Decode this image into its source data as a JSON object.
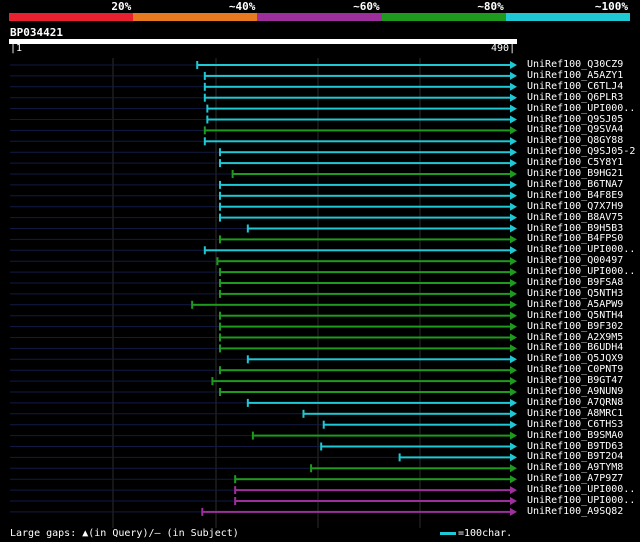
{
  "legend": {
    "colors": [
      "#e8202f",
      "#e8791e",
      "#9c2f9c",
      "#1e9a1e",
      "#1ec8d4"
    ],
    "labels": [
      "20%",
      "~40%",
      "~60%",
      "~80%",
      "~100%"
    ]
  },
  "query": {
    "name": "BP034421",
    "start": "1",
    "end": "490"
  },
  "hits": [
    {
      "label": "UniRef100_Q30CZ9",
      "color": "cyan",
      "start": 0.37
    },
    {
      "label": "UniRef100_A5AZY1",
      "color": "cyan",
      "start": 0.385
    },
    {
      "label": "UniRef100_C6TLJ4",
      "color": "cyan",
      "start": 0.385
    },
    {
      "label": "UniRef100_Q6PLR3",
      "color": "cyan",
      "start": 0.385
    },
    {
      "label": "UniRef100_UPI000..",
      "color": "cyan",
      "start": 0.39
    },
    {
      "label": "UniRef100_Q9SJ05",
      "color": "cyan",
      "start": 0.39
    },
    {
      "label": "UniRef100_Q9SVA4",
      "color": "green",
      "start": 0.385
    },
    {
      "label": "UniRef100_Q8GY88",
      "color": "cyan",
      "start": 0.385
    },
    {
      "label": "UniRef100_Q9SJ05-2",
      "color": "cyan",
      "start": 0.415
    },
    {
      "label": "UniRef100_C5Y8Y1",
      "color": "cyan",
      "start": 0.415
    },
    {
      "label": "UniRef100_B9HG21",
      "color": "green",
      "start": 0.44
    },
    {
      "label": "UniRef100_B6TNA7",
      "color": "cyan",
      "start": 0.415
    },
    {
      "label": "UniRef100_B4F8E9",
      "color": "cyan",
      "start": 0.415
    },
    {
      "label": "UniRef100_Q7X7H9",
      "color": "cyan",
      "start": 0.415
    },
    {
      "label": "UniRef100_B8AV75",
      "color": "cyan",
      "start": 0.415
    },
    {
      "label": "UniRef100_B9H5B3",
      "color": "cyan",
      "start": 0.47
    },
    {
      "label": "UniRef100_B4FPS0",
      "color": "green",
      "start": 0.415
    },
    {
      "label": "UniRef100_UPI000..",
      "color": "cyan",
      "start": 0.385
    },
    {
      "label": "UniRef100_Q00497",
      "color": "green",
      "start": 0.41
    },
    {
      "label": "UniRef100_UPI000..",
      "color": "green",
      "start": 0.415
    },
    {
      "label": "UniRef100_B9FSA8",
      "color": "green",
      "start": 0.415
    },
    {
      "label": "UniRef100_Q5NTH3",
      "color": "green",
      "start": 0.415
    },
    {
      "label": "UniRef100_A5APW9",
      "color": "green",
      "start": 0.36
    },
    {
      "label": "UniRef100_Q5NTH4",
      "color": "green",
      "start": 0.415
    },
    {
      "label": "UniRef100_B9F302",
      "color": "green",
      "start": 0.415
    },
    {
      "label": "UniRef100_A2X9M5",
      "color": "green",
      "start": 0.415
    },
    {
      "label": "UniRef100_B6UDH4",
      "color": "green",
      "start": 0.415
    },
    {
      "label": "UniRef100_Q5JQX9",
      "color": "cyan",
      "start": 0.47
    },
    {
      "label": "UniRef100_C0PNT9",
      "color": "green",
      "start": 0.415
    },
    {
      "label": "UniRef100_B9GT47",
      "color": "green",
      "start": 0.4
    },
    {
      "label": "UniRef100_A9NUN9",
      "color": "green",
      "start": 0.415
    },
    {
      "label": "UniRef100_A7QRN8",
      "color": "cyan",
      "start": 0.47
    },
    {
      "label": "UniRef100_A8MRC1",
      "color": "cyan",
      "start": 0.58
    },
    {
      "label": "UniRef100_C6THS3",
      "color": "cyan",
      "start": 0.62
    },
    {
      "label": "UniRef100_B9SMA0",
      "color": "green",
      "start": 0.48
    },
    {
      "label": "UniRef100_B9TD63",
      "color": "cyan",
      "start": 0.615
    },
    {
      "label": "UniRef100_B9T2O4",
      "color": "cyan",
      "start": 0.77
    },
    {
      "label": "UniRef100_A9TYM8",
      "color": "green",
      "start": 0.595
    },
    {
      "label": "UniRef100_A7P9Z7",
      "color": "green",
      "start": 0.445
    },
    {
      "label": "UniRef100_UPI000..",
      "color": "magenta",
      "start": 0.445
    },
    {
      "label": "UniRef100_UPI000..",
      "color": "magenta",
      "start": 0.445
    },
    {
      "label": "UniRef100_A9SQ82",
      "color": "magenta",
      "start": 0.38
    }
  ],
  "footer": {
    "text": "Large gaps: ▲(in Query)/— (in Subject)",
    "scale_text": "=100char."
  }
}
